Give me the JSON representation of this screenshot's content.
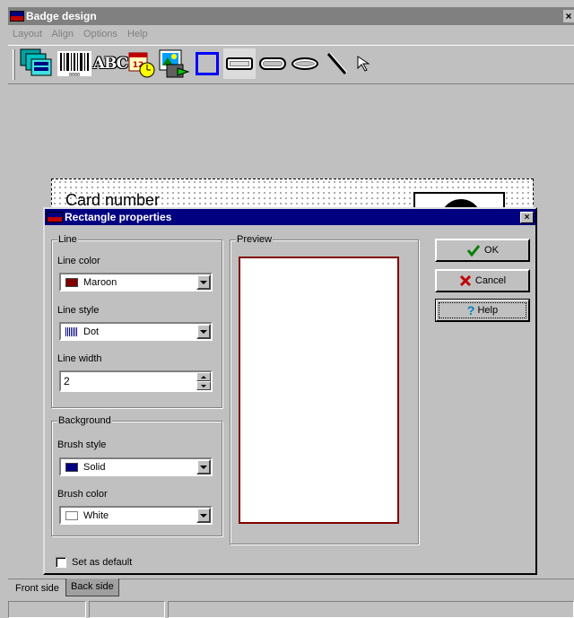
{
  "window": {
    "title": "Badge design",
    "close_glyph": "×"
  },
  "menu": [
    "Layout",
    "Align",
    "Options",
    "Help"
  ],
  "toolbar": {
    "items": [
      "layers-tool",
      "barcode-tool",
      "text-tool",
      "date-tool",
      "image-tool",
      "rectangle-tool",
      "rounded-rectangle-tool",
      "rounded-ellipse-tool",
      "ellipse-tool",
      "line-tool",
      "pointer-tool"
    ],
    "text_tool_glyph": "ABC"
  },
  "canvas": {
    "card_text": "Card number"
  },
  "dialog": {
    "title": "Rectangle properties",
    "close_glyph": "×",
    "line_group": {
      "label": "Line",
      "line_color_label": "Line color",
      "line_color_value": "Maroon",
      "line_color_swatch": "#800000",
      "line_style_label": "Line style",
      "line_style_value": "Dot",
      "line_width_label": "Line width",
      "line_width_value": "2"
    },
    "background_group": {
      "label": "Background",
      "brush_style_label": "Brush style",
      "brush_style_value": "Solid",
      "brush_style_swatch": "#000080",
      "brush_color_label": "Brush color",
      "brush_color_value": "White",
      "brush_color_swatch": "#ffffff"
    },
    "preview": {
      "label": "Preview",
      "border_color": "#800000"
    },
    "buttons": {
      "ok": "OK",
      "cancel": "Cancel",
      "help": "Help"
    },
    "set_default_label": "Set as default"
  },
  "tabs": [
    "Front side",
    "Back side"
  ]
}
